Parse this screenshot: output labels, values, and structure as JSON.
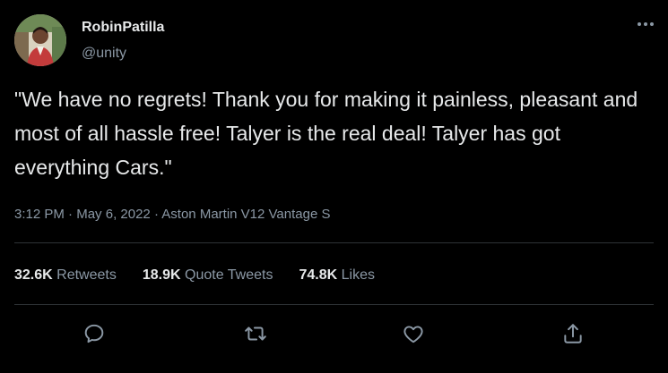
{
  "user": {
    "display_name": "RobinPatilla",
    "handle": "@unity",
    "avatar_icon": "profile-photo"
  },
  "tweet": {
    "text": "\"We have no regrets! Thank you for making it painless, pleasant and most of all hassle free! Talyer is the real deal! Talyer has got everything Cars.\"",
    "time": "3:12 PM",
    "date": "May 6, 2022",
    "source": "Aston Martin V12 Vantage S",
    "separator": " · "
  },
  "stats": {
    "retweets_count": "32.6K",
    "retweets_label": "Retweets",
    "quotes_count": "18.9K",
    "quotes_label": "Quote Tweets",
    "likes_count": "74.8K",
    "likes_label": "Likes"
  },
  "actions": {
    "icons": [
      "reply-icon",
      "retweet-icon",
      "like-icon",
      "share-icon"
    ]
  },
  "colors": {
    "background": "#000000",
    "primary_text": "#e7e9ea",
    "secondary_text": "#8b98a5",
    "divider": "#2f3336"
  }
}
